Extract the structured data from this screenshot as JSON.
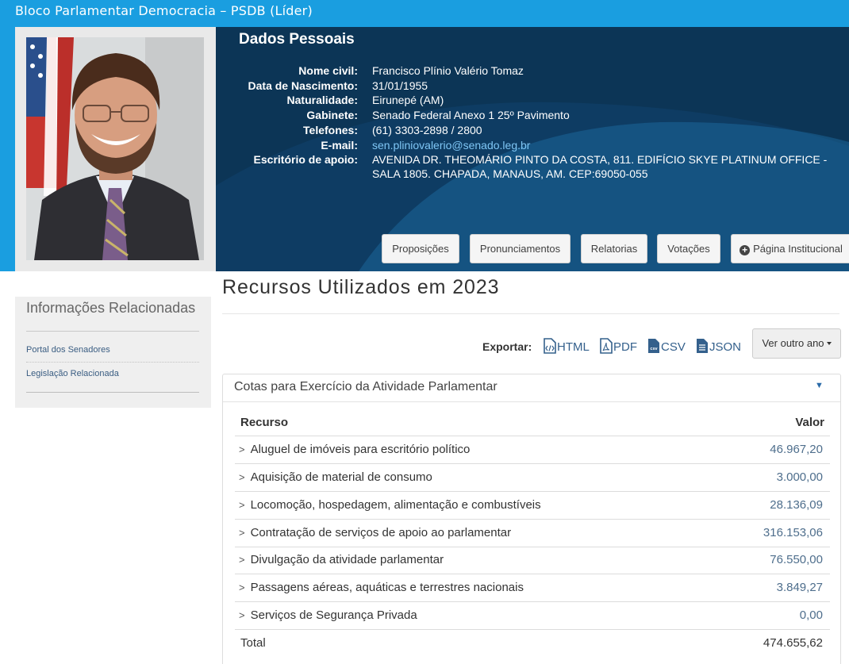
{
  "topbar": {
    "title": "Bloco Parlamentar Democracia – PSDB (Líder)"
  },
  "profile": {
    "heading": "Dados Pessoais",
    "fields": [
      {
        "label": "Nome civil:",
        "value": "Francisco Plínio Valério Tomaz"
      },
      {
        "label": "Data de Nascimento:",
        "value": "31/01/1955"
      },
      {
        "label": "Naturalidade:",
        "value": "Eirunepé (AM)"
      },
      {
        "label": "Gabinete:",
        "value": "Senado Federal Anexo 1 25º Pavimento"
      },
      {
        "label": "Telefones:",
        "value": "(61) 3303-2898 / 2800"
      },
      {
        "label": "E-mail:",
        "value": "sen.pliniovalerio@senado.leg.br"
      },
      {
        "label": "Escritório de apoio:",
        "value": "AVENIDA DR. THEOMÁRIO PINTO DA COSTA, 811. EDIFÍCIO SKYE PLATINUM OFFICE - SALA 1805. CHAPADA, MANAUS, AM. CEP:69050-055"
      }
    ],
    "tabs": [
      "Proposições",
      "Pronunciamentos",
      "Relatorias",
      "Votações",
      "Página Institucional"
    ]
  },
  "sidebar": {
    "title": "Informações Relacionadas",
    "links": [
      "Portal dos Senadores",
      "Legislação Relacionada"
    ]
  },
  "main": {
    "title": "Recursos Utilizados em 2023",
    "export_label": "Exportar:",
    "export_formats": [
      "HTML",
      "PDF",
      "CSV",
      "JSON"
    ],
    "year_button": "Ver outro ano"
  },
  "accordion": {
    "title": "Cotas para Exercício da Atividade Parlamentar",
    "toggle_icon": "▼",
    "col_resource": "Recurso",
    "col_value": "Valor",
    "rows": [
      {
        "label": "Aluguel de imóveis para escritório político",
        "value": "46.967,20"
      },
      {
        "label": "Aquisição de material de consumo",
        "value": "3.000,00"
      },
      {
        "label": "Locomoção, hospedagem, alimentação e combustíveis",
        "value": "28.136,09"
      },
      {
        "label": "Contratação de serviços de apoio ao parlamentar",
        "value": "316.153,06"
      },
      {
        "label": "Divulgação da atividade parlamentar",
        "value": "76.550,00"
      },
      {
        "label": "Passagens aéreas, aquáticas e terrestres nacionais",
        "value": "3.849,27"
      },
      {
        "label": "Serviços de Segurança Privada",
        "value": "0,00"
      }
    ],
    "total_label": "Total",
    "total_value": "474.655,62"
  },
  "colors": {
    "topbar": "#1a9ee0",
    "panel": "#0c3556",
    "link": "#7fc6f5",
    "value": "#4e6e8c"
  }
}
